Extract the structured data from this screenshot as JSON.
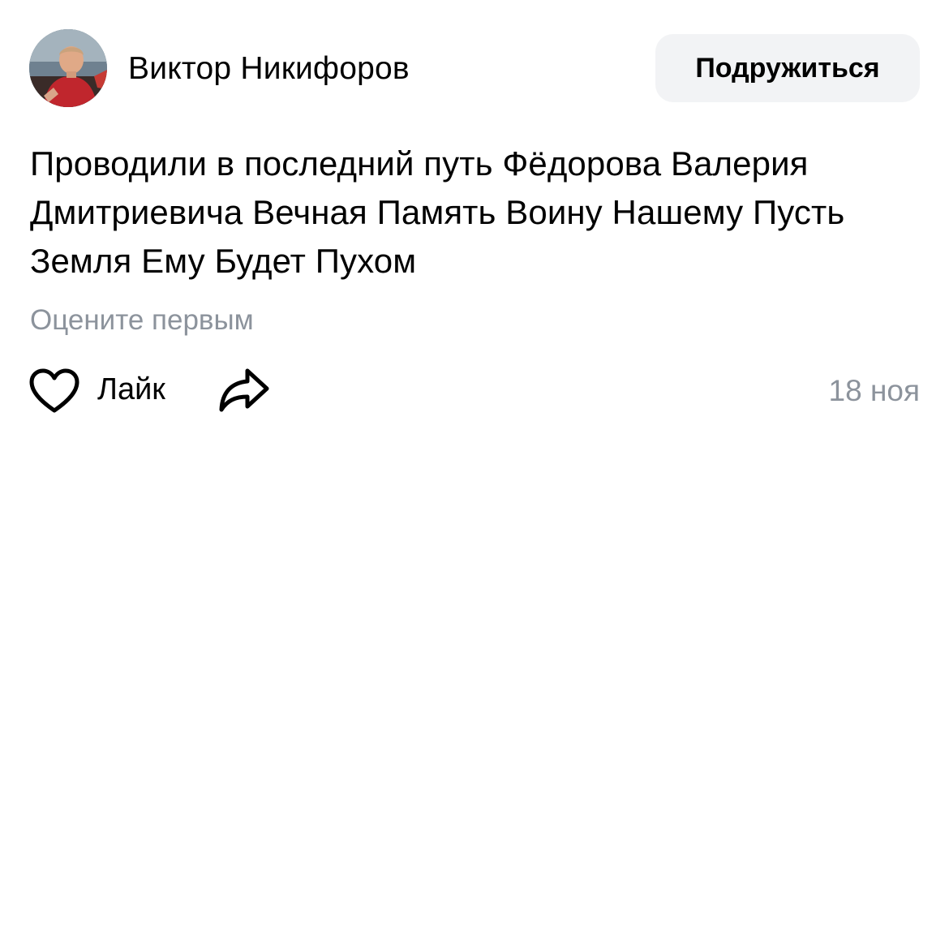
{
  "author": {
    "name": "Виктор Никифоров",
    "avatar_icon": "user-photo-avatar"
  },
  "header": {
    "friend_button_label": "Подружиться"
  },
  "post": {
    "text": "Проводили в последний путь Фёдорова Валерия Дмитриевича Вечная Память Воину Нашему Пусть Земля Ему Будет Пухом",
    "rate_hint": "Оцените первым",
    "date": "18 ноя"
  },
  "actions": {
    "like_label": "Лайк",
    "like_icon": "heart-icon",
    "share_icon": "share-icon"
  },
  "colors": {
    "background": "#ffffff",
    "text": "#000000",
    "secondary_text": "#8c939c",
    "button_background": "#f2f3f5"
  }
}
